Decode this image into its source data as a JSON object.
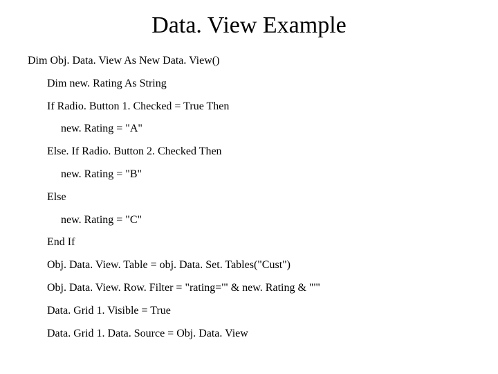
{
  "title": "Data. View Example",
  "code": {
    "l0": "Dim Obj. Data. View As New Data. View()",
    "l1": "Dim new. Rating As String",
    "l2": "If Radio. Button 1. Checked = True Then",
    "l3": "new. Rating = \"A\"",
    "l4": "Else. If Radio. Button 2. Checked Then",
    "l5": "new. Rating = \"B\"",
    "l6": "Else",
    "l7": "new. Rating = \"C\"",
    "l8": "End If",
    "l9": "Obj. Data. View. Table = obj. Data. Set. Tables(\"Cust\")",
    "l10": "Obj. Data. View. Row. Filter = \"rating='\" & new. Rating & \"'\"",
    "l11": "Data. Grid 1. Visible = True",
    "l12": "Data. Grid 1. Data. Source = Obj. Data. View"
  }
}
